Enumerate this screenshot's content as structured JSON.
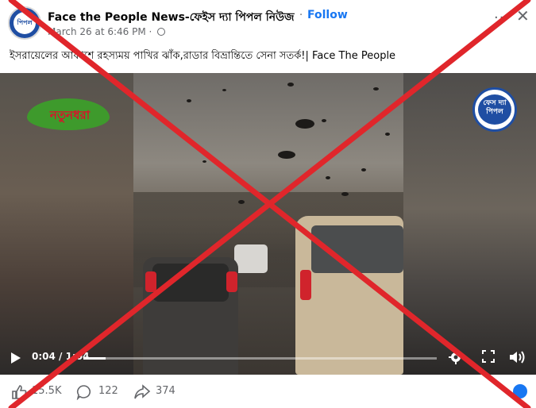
{
  "post": {
    "page_name": "Face the People News-ফেইস দ্যা পিপল নিউজ",
    "separator": "·",
    "follow_label": "Follow",
    "timestamp": "March 26 at 6:46 PM ·",
    "more_label": "···",
    "close_label": "✕",
    "caption": "ইসরায়েলের আকাশে রহস্যময় পাখির ঝাঁক,রাডার বিভ্রান্তিতে সেনা সতর্ক!| Face The People"
  },
  "avatar": {
    "text": "পিপল"
  },
  "video": {
    "time": "0:04 / 1:04",
    "progress_fraction": 0.0625,
    "logo_left_text": "নতুনধরা",
    "logo_right_text": "ফেস দ্যা পিপল"
  },
  "reactions": {
    "likes": "15.5K",
    "comments": "122",
    "shares": "374"
  },
  "colors": {
    "follow": "#1877f2",
    "cross": "#e0262b",
    "muted": "#65676b"
  },
  "icons": [
    "globe-icon",
    "like-icon",
    "comment-icon",
    "share-icon",
    "play-icon",
    "settings-icon",
    "fullscreen-icon",
    "volume-icon"
  ]
}
